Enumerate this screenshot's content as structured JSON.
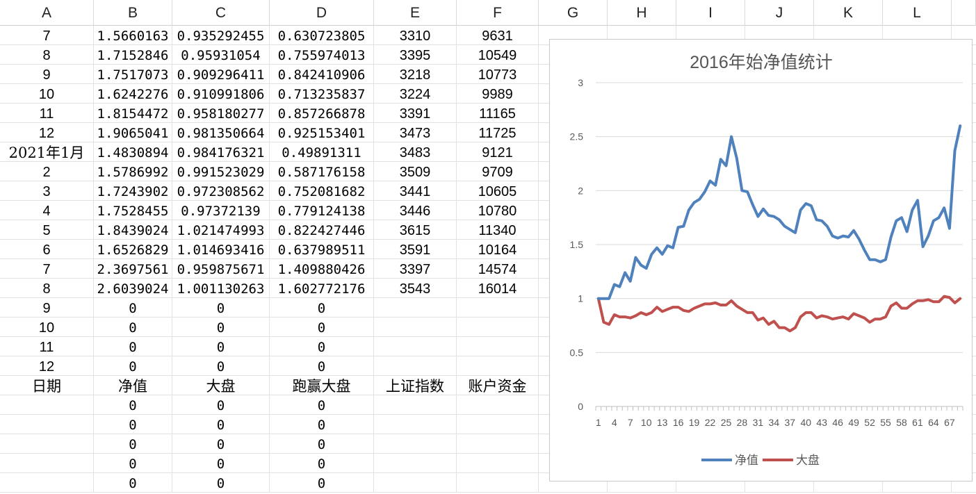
{
  "columns": [
    "A",
    "B",
    "C",
    "D",
    "E",
    "F",
    "G",
    "H",
    "I",
    "J",
    "K",
    "L"
  ],
  "rows": [
    [
      "7",
      "1.5660163",
      "0.935292455",
      "0.630723805",
      "3310",
      "9631"
    ],
    [
      "8",
      "1.7152846",
      "0.95931054",
      "0.755974013",
      "3395",
      "10549"
    ],
    [
      "9",
      "1.7517073",
      "0.909296411",
      "0.842410906",
      "3218",
      "10773"
    ],
    [
      "10",
      "1.6242276",
      "0.910991806",
      "0.713235837",
      "3224",
      "9989"
    ],
    [
      "11",
      "1.8154472",
      "0.958180277",
      "0.857266878",
      "3391",
      "11165"
    ],
    [
      "12",
      "1.9065041",
      "0.981350664",
      "0.925153401",
      "3473",
      "11725"
    ],
    [
      "2021年1月",
      "1.4830894",
      "0.984176321",
      "0.49891311",
      "3483",
      "9121"
    ],
    [
      "2",
      "1.5786992",
      "0.991523029",
      "0.587176158",
      "3509",
      "9709"
    ],
    [
      "3",
      "1.7243902",
      "0.972308562",
      "0.752081682",
      "3441",
      "10605"
    ],
    [
      "4",
      "1.7528455",
      "0.97372139",
      "0.779124138",
      "3446",
      "10780"
    ],
    [
      "5",
      "1.8439024",
      "1.021474993",
      "0.822427446",
      "3615",
      "11340"
    ],
    [
      "6",
      "1.6526829",
      "1.014693416",
      "0.637989511",
      "3591",
      "10164"
    ],
    [
      "7",
      "2.3697561",
      "0.959875671",
      "1.409880426",
      "3397",
      "14574"
    ],
    [
      "8",
      "2.6039024",
      "1.001130263",
      "1.602772176",
      "3543",
      "16014"
    ],
    [
      "9",
      "0",
      "0",
      "0",
      "",
      ""
    ],
    [
      "10",
      "0",
      "0",
      "0",
      "",
      ""
    ],
    [
      "11",
      "0",
      "0",
      "0",
      "",
      ""
    ],
    [
      "12",
      "0",
      "0",
      "0",
      "",
      ""
    ],
    [
      "日期",
      "净值",
      "大盘",
      "跑赢大盘",
      "上证指数",
      "账户资金"
    ],
    [
      "",
      "0",
      "0",
      "0",
      "",
      ""
    ],
    [
      "",
      "0",
      "0",
      "0",
      "",
      ""
    ],
    [
      "",
      "0",
      "0",
      "0",
      "",
      ""
    ],
    [
      "",
      "0",
      "0",
      "0",
      "",
      ""
    ],
    [
      "",
      "0",
      "0",
      "0",
      "",
      ""
    ]
  ],
  "colors": {
    "series1": "#4f81bd",
    "series2": "#c0504d",
    "grid": "#d9d9d9"
  },
  "chart_data": {
    "type": "line",
    "title": "2016年始净值统计",
    "xlabel": "",
    "ylabel": "",
    "ylim": [
      0,
      3
    ],
    "yticks": [
      "0",
      "0.5",
      "1",
      "1.5",
      "2",
      "2.5",
      "3"
    ],
    "xticks": [
      "1",
      "4",
      "7",
      "10",
      "13",
      "16",
      "19",
      "22",
      "25",
      "28",
      "31",
      "34",
      "37",
      "40",
      "43",
      "46",
      "49",
      "52",
      "55",
      "58",
      "61",
      "64",
      "67"
    ],
    "legend_position": "bottom",
    "grid": true,
    "series": [
      {
        "name": "净值",
        "values": [
          1.0,
          1.0,
          1.0,
          1.13,
          1.11,
          1.24,
          1.16,
          1.38,
          1.31,
          1.28,
          1.41,
          1.47,
          1.41,
          1.49,
          1.47,
          1.66,
          1.67,
          1.82,
          1.89,
          1.92,
          1.99,
          2.09,
          2.05,
          2.29,
          2.23,
          2.5,
          2.3,
          2.0,
          1.99,
          1.87,
          1.76,
          1.83,
          1.77,
          1.76,
          1.73,
          1.67,
          1.64,
          1.61,
          1.82,
          1.88,
          1.86,
          1.73,
          1.72,
          1.67,
          1.58,
          1.56,
          1.58,
          1.57,
          1.63,
          1.55,
          1.45,
          1.36,
          1.36,
          1.34,
          1.36,
          1.57,
          1.72,
          1.75,
          1.62,
          1.82,
          1.91,
          1.48,
          1.58,
          1.72,
          1.75,
          1.84,
          1.65,
          2.37,
          2.6
        ]
      },
      {
        "name": "大盘",
        "values": [
          1.0,
          0.78,
          0.76,
          0.85,
          0.83,
          0.83,
          0.82,
          0.84,
          0.87,
          0.85,
          0.87,
          0.92,
          0.88,
          0.9,
          0.92,
          0.92,
          0.89,
          0.88,
          0.91,
          0.93,
          0.95,
          0.95,
          0.96,
          0.94,
          0.94,
          0.98,
          0.93,
          0.9,
          0.87,
          0.87,
          0.8,
          0.82,
          0.76,
          0.79,
          0.73,
          0.73,
          0.7,
          0.73,
          0.83,
          0.87,
          0.87,
          0.82,
          0.84,
          0.83,
          0.81,
          0.82,
          0.83,
          0.81,
          0.86,
          0.84,
          0.82,
          0.78,
          0.81,
          0.81,
          0.83,
          0.93,
          0.96,
          0.91,
          0.91,
          0.95,
          0.98,
          0.98,
          0.99,
          0.97,
          0.97,
          1.02,
          1.01,
          0.96,
          1.0
        ]
      }
    ]
  }
}
